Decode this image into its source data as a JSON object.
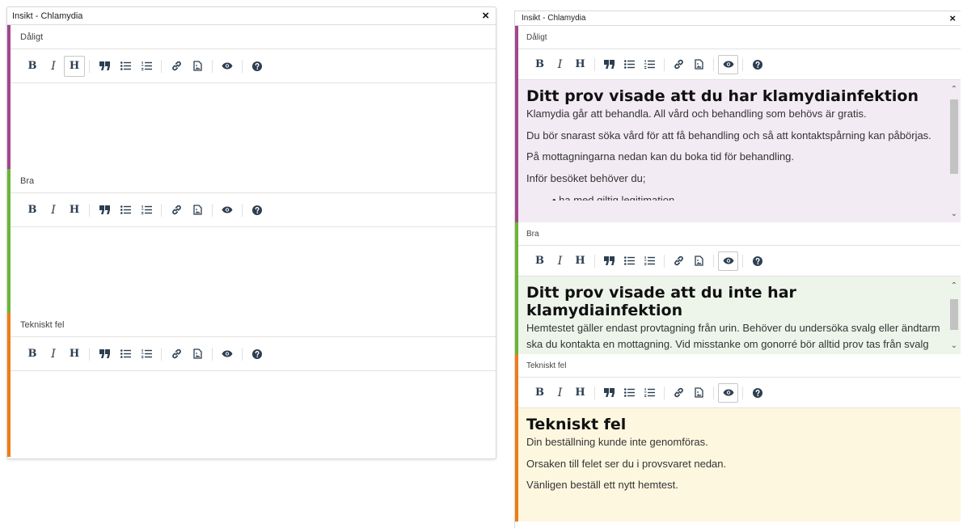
{
  "left": {
    "title": "Insikt - Chlamydia",
    "close": "×",
    "sections": [
      {
        "label": "Dåligt"
      },
      {
        "label": "Bra"
      },
      {
        "label": "Tekniskt fel"
      }
    ]
  },
  "right": {
    "title": "Insikt - Chlamydia",
    "close": "×",
    "sections": [
      {
        "label": "Dåligt",
        "heading": "Ditt prov visade att du har klamydiainfektion",
        "paragraphs": [
          "Klamydia går att behandla. All vård och behandling som behövs är gratis.",
          "Du bör snarast söka vård för att få behandling och så att kontaktspårning kan påbörjas.",
          "På mottagningarna nedan kan du boka tid för behandling.",
          "Inför besöket behöver du;"
        ],
        "list_item": "ha med giltig legitimation"
      },
      {
        "label": "Bra",
        "heading": "Ditt prov visade att du inte har klamydiainfektion",
        "paragraphs": [
          "Hemtestet gäller endast provtagning från urin. Behöver du undersöka svalg eller ändtarm ska du kontakta en mottagning. Vid misstanke om gonorré bör alltid prov tas från svalg och ändtarm för att utesluta smitta."
        ]
      },
      {
        "label": "Tekniskt fel",
        "heading": "Tekniskt fel",
        "paragraphs": [
          "Din beställning kunde inte genomföras.",
          "Orsaken till felet ser du i provsvaret nedan.",
          "Vänligen beställ ett nytt hemtest."
        ]
      }
    ]
  },
  "toolbar": {
    "bold": "B",
    "italic": "I",
    "heading": "H",
    "icons": [
      "bold-icon",
      "italic-icon",
      "heading-icon",
      "quote-icon",
      "unordered-list-icon",
      "ordered-list-icon",
      "link-icon",
      "image-icon",
      "preview-eye-icon",
      "help-icon"
    ]
  },
  "scroll": {
    "up": "⌃",
    "down": "⌄"
  },
  "colors": {
    "bad": "#a2468c",
    "good": "#6ab535",
    "error": "#ee7d17",
    "bad_bg": "#f3ebf4",
    "good_bg": "#edf5ea",
    "error_bg": "#fef7e0"
  }
}
